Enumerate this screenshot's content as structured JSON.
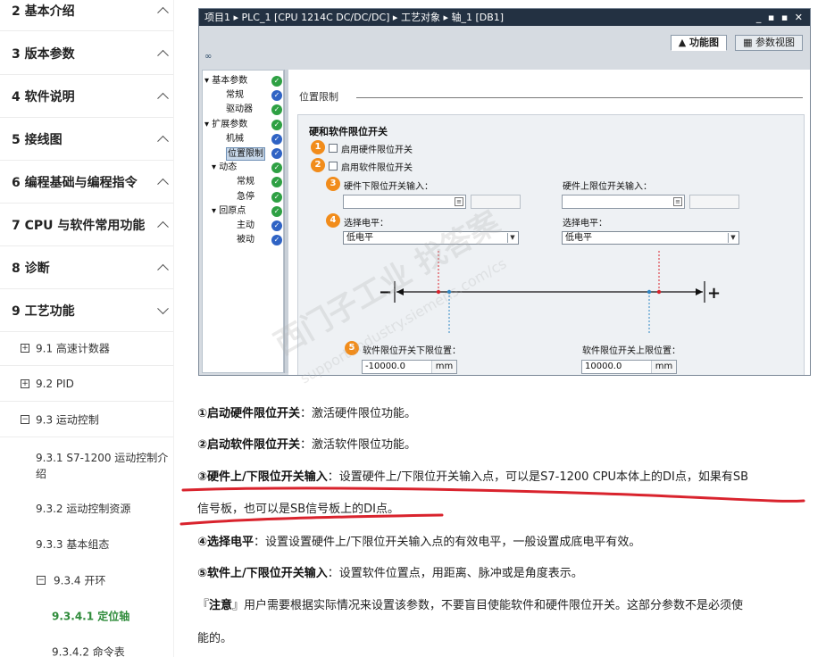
{
  "nav": {
    "sections": [
      {
        "label": "2 基本介绍",
        "state": "expanded"
      },
      {
        "label": "3 版本参数",
        "state": "expanded"
      },
      {
        "label": "4 软件说明",
        "state": "expanded"
      },
      {
        "label": "5 接线图",
        "state": "expanded"
      },
      {
        "label": "6 编程基础与编程指令",
        "state": "expanded"
      },
      {
        "label": "7 CPU 与软件常用功能",
        "state": "expanded"
      },
      {
        "label": "8 诊断",
        "state": "expanded"
      },
      {
        "label": "9 工艺功能",
        "state": "collapsed"
      }
    ],
    "subsections": [
      {
        "box": "+",
        "label": "9.1 高速计数器"
      },
      {
        "box": "+",
        "label": "9.2 PID"
      },
      {
        "box": "−",
        "label": "9.3 运动控制"
      }
    ],
    "third": [
      {
        "label": "9.3.1 S7-1200 运动控制介绍"
      },
      {
        "label": "9.3.2 运动控制资源"
      },
      {
        "label": "9.3.3 基本组态"
      }
    ],
    "fourth": {
      "box": "−",
      "label": "9.3.4 开环"
    },
    "leaves": [
      {
        "label": "9.3.4.1 定位轴",
        "active": true
      },
      {
        "label": "9.3.4.2 命令表",
        "active": false
      }
    ]
  },
  "panel": {
    "title_bar": "项目1 ▸ PLC_1 [CPU 1214C DC/DC/DC] ▸ 工艺对象 ▸ 轴_1 [DB1]",
    "win_buttons": "_ ▪ ▪ ✕",
    "tabs": {
      "function_view": "功能图",
      "param_view": "参数视图"
    },
    "tree": [
      {
        "label": "▾ 基本参数",
        "status": "green",
        "indent": 0
      },
      {
        "label": "常规",
        "status": "blue",
        "indent": 2
      },
      {
        "label": "驱动器",
        "status": "green",
        "indent": 2
      },
      {
        "label": "▾ 扩展参数",
        "status": "green",
        "indent": 0
      },
      {
        "label": "机械",
        "status": "blue",
        "indent": 2
      },
      {
        "label": "位置限制",
        "status": "blue",
        "indent": 2,
        "selected": true
      },
      {
        "label": "▾ 动态",
        "status": "green",
        "indent": 1
      },
      {
        "label": "常规",
        "status": "green",
        "indent": 3
      },
      {
        "label": "急停",
        "status": "green",
        "indent": 3
      },
      {
        "label": "▾ 回原点",
        "status": "green",
        "indent": 1
      },
      {
        "label": "主动",
        "status": "blue",
        "indent": 3
      },
      {
        "label": "被动",
        "status": "blue",
        "indent": 3
      }
    ],
    "section_title": "位置限制",
    "group_title": "硬和软件限位开关",
    "checkbox_hw": "启用硬件限位开关",
    "checkbox_sw": "启用软件限位开关",
    "hw_low_label": "硬件下限位开关输入：",
    "hw_high_label": "硬件上限位开关输入：",
    "level_label_left": "选择电平：",
    "level_label_right": "选择电平：",
    "level_left_value": "低电平",
    "level_right_value": "低电平",
    "sw_low_label": "软件限位开关下限位置：",
    "sw_high_label": "软件限位开关上限位置：",
    "sw_low_value": "-10000.0",
    "sw_high_value": "10000.0",
    "unit": "mm",
    "minus": "−",
    "plus": "+",
    "badges": [
      "1",
      "2",
      "3",
      "4",
      "5"
    ]
  },
  "article": {
    "p1_bold": "①启动硬件限位开关",
    "p1_text": "：激活硬件限位功能。",
    "p2_bold": "②启动软件限位开关",
    "p2_text": "：激活软件限位功能。",
    "p3_bold": "③硬件上/下限位开关输入",
    "p3_text": "：设置硬件上/下限位开关输入点，可以是S7-1200 CPU本体上的DI点，如果有SB",
    "p3_cont": "信号板，也可以是SB信号板上的DI点。",
    "p4_bold": "④选择电平",
    "p4_text": "：设置设置硬件上/下限位开关输入点的有效电平，一般设置成底电平有效。",
    "p5_bold": "⑤软件上/下限位开关输入",
    "p5_text": "：设置软件位置点，用距离、脉冲或是角度表示。",
    "p6_prefix": "『",
    "p6_bold": "注意",
    "p6_text": "』用户需要根据实际情况来设置该参数，不要盲目使能软件和硬件限位开关。这部分参数不是必须使",
    "p6_cont": "能的。"
  },
  "watermark": {
    "line1": "西门子工业 找答案",
    "line2": "support.industry.siemens.com/cs"
  },
  "colors": {
    "active_nav": "#2e8b3a",
    "badge": "#f18c1b",
    "underline": "#d9232d",
    "title_bar": "#233142"
  }
}
